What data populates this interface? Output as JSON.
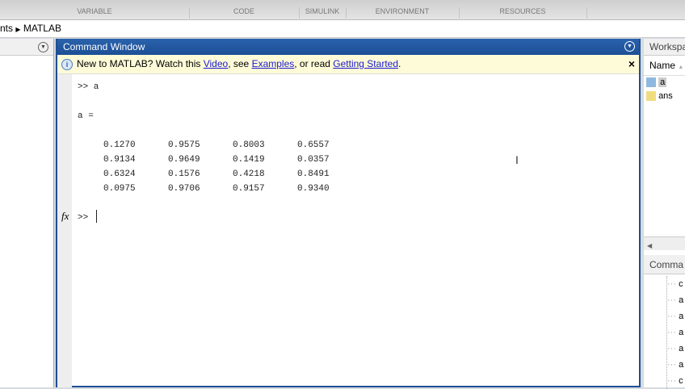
{
  "toolstrip": {
    "sections": [
      "VARIABLE",
      "CODE",
      "SIMULINK",
      "ENVIRONMENT",
      "RESOURCES"
    ]
  },
  "address": {
    "partial": "nts",
    "current": "MATLAB"
  },
  "command_window": {
    "title": "Command Window",
    "banner": {
      "prefix": "New to MATLAB? Watch this ",
      "video": "Video",
      "mid1": ", see ",
      "examples": "Examples",
      "mid2": ", or read ",
      "getting_started": "Getting Started",
      "suffix": "."
    },
    "input_line": ">> a",
    "output_label": "a =",
    "matrix": [
      [
        "0.1270",
        "0.9575",
        "0.8003",
        "0.6557"
      ],
      [
        "0.9134",
        "0.9649",
        "0.1419",
        "0.0357"
      ],
      [
        "0.6324",
        "0.1576",
        "0.4218",
        "0.8491"
      ],
      [
        "0.0975",
        "0.9706",
        "0.9157",
        "0.9340"
      ]
    ],
    "prompt": ">>",
    "fx": "fx"
  },
  "workspace": {
    "title": "Workspa",
    "column": "Name",
    "items": [
      "a",
      "ans"
    ]
  },
  "history": {
    "title": "Comma",
    "items": [
      "c",
      "a",
      "a",
      "a",
      "a",
      "a",
      "c"
    ]
  }
}
